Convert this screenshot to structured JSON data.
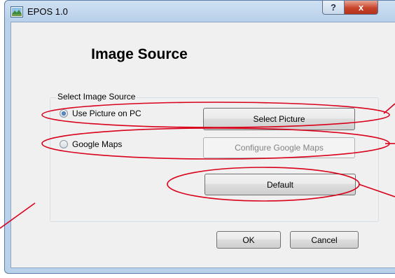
{
  "window": {
    "title": "EPOS 1.0",
    "help_label": "?",
    "close_label": "x"
  },
  "dialog": {
    "heading": "Image Source",
    "group_label": "Select Image Source",
    "options": [
      {
        "label": "Use Picture on PC",
        "selected": true
      },
      {
        "label": "Google Maps",
        "selected": false
      }
    ],
    "buttons": {
      "select_picture": "Select Picture",
      "configure_maps": "Configure Google Maps",
      "default": "Default",
      "ok": "OK",
      "cancel": "Cancel"
    }
  },
  "colors": {
    "annotation": "#d9001b",
    "title_bar": "#b9d1ea",
    "close_button": "#c7432a"
  }
}
